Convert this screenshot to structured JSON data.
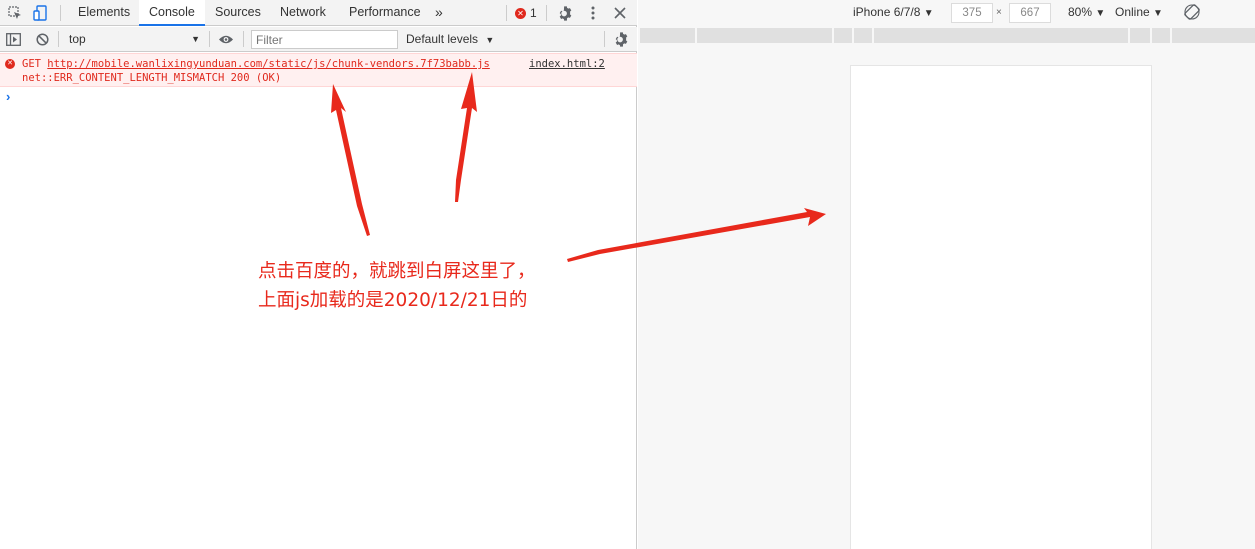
{
  "tabs": [
    {
      "label": "Elements"
    },
    {
      "label": "Console",
      "active": true
    },
    {
      "label": "Sources"
    },
    {
      "label": "Network"
    },
    {
      "label": "Performance"
    }
  ],
  "more_tabs": "»",
  "error_count": "1",
  "console_toolbar": {
    "context": "top",
    "filter_placeholder": "Filter",
    "levels": "Default levels"
  },
  "console_messages": [
    {
      "level": "error",
      "method": "GET",
      "url": "http://mobile.wanlixingyunduan.com/static/js/chunk-vendors.7f73babb.js",
      "source": "index.html:2",
      "detail": "net::ERR_CONTENT_LENGTH_MISMATCH 200 (OK)"
    }
  ],
  "prompt": "›",
  "device_toolbar": {
    "device": "iPhone 6/7/8",
    "width": "375",
    "height": "667",
    "times": "×",
    "zoom": "80%",
    "network": "Online"
  },
  "annotation": {
    "line1": "点击百度的，就跳到白屏这里了，",
    "line2": "上面js加载的是2020/12/21日的",
    "color": "#e8291c"
  },
  "colors": {
    "accent": "#1a73e8",
    "error": "#e0291d",
    "error_bg": "#fff0f0"
  }
}
